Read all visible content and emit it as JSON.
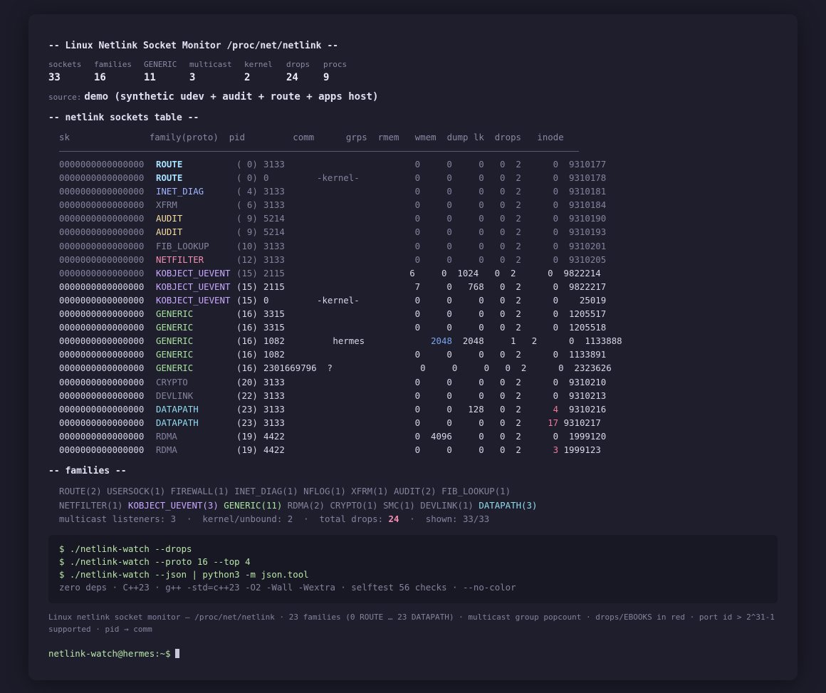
{
  "title": "-- Linux Netlink Socket Monitor /proc/net/netlink --",
  "stats": [
    {
      "label": "sockets",
      "value": "33"
    },
    {
      "label": "families",
      "value": "16"
    },
    {
      "label": "GENERIC",
      "value": "11"
    },
    {
      "label": "multicast",
      "value": "3"
    },
    {
      "label": "kernel",
      "value": "2"
    },
    {
      "label": "drops",
      "value": "24"
    },
    {
      "label": "procs",
      "value": "9"
    }
  ],
  "source": {
    "label": "source:",
    "value": "demo (synthetic udev + audit + route + apps host)"
  },
  "table_section": "-- netlink sockets table --",
  "table_header": "sk               family(proto)  pid         comm      grps  rmem   wmem  dump lk  drops   inode",
  "rows": [
    {
      "sk": "0000000000000000",
      "family": "ROUTE",
      "cls": "f-route",
      "proto": "( 0)",
      "pid": "3133",
      "comm": "",
      "rest": "        0     0     0   0  2      0  9310177",
      "dim": true
    },
    {
      "sk": "0000000000000000",
      "family": "ROUTE",
      "cls": "f-route",
      "proto": "( 0)",
      "pid": "0",
      "comm": "-kernel-",
      "rest": "        0     0     0   0  2      0  9310178",
      "dim": true
    },
    {
      "sk": "0000000000000000",
      "family": "INET_DIAG",
      "cls": "f-inet",
      "proto": "( 4)",
      "pid": "3133",
      "comm": "",
      "rest": "        0     0     0   0  2      0  9310181",
      "dim": true
    },
    {
      "sk": "0000000000000000",
      "family": "XFRM",
      "cls": "f-xfrm",
      "proto": "( 6)",
      "pid": "3133",
      "comm": "",
      "rest": "        0     0     0   0  2      0  9310184",
      "dim": true
    },
    {
      "sk": "0000000000000000",
      "family": "AUDIT",
      "cls": "f-audit",
      "proto": "( 9)",
      "pid": "5214",
      "comm": "",
      "rest": "        0     0     0   0  2      0  9310190",
      "dim": true
    },
    {
      "sk": "0000000000000000",
      "family": "AUDIT",
      "cls": "f-audit",
      "proto": "( 9)",
      "pid": "5214",
      "comm": "",
      "rest": "        0     0     0   0  2      0  9310193",
      "dim": true
    },
    {
      "sk": "0000000000000000",
      "family": "FIB_LOOKUP",
      "cls": "f-fib",
      "proto": "(10)",
      "pid": "3133",
      "comm": "",
      "rest": "        0     0     0   0  2      0  9310201",
      "dim": true
    },
    {
      "sk": "0000000000000000",
      "family": "NETFILTER",
      "cls": "f-nf",
      "proto": "(12)",
      "pid": "3133",
      "comm": "",
      "rest": "        0     0     0   0  2      0  9310205",
      "dim": true
    },
    {
      "sk": "0000000000000000",
      "family": "KOBJECT_UEVENT",
      "cls": "f-kob",
      "proto": "(15)",
      "pid": "2115",
      "comm": "",
      "rest": "       6     0  1024   0  2      0  9822214",
      "dim": true,
      "brightrest": true
    },
    {
      "sk": "0000000000000000",
      "family": "KOBJECT_UEVENT",
      "cls": "f-kob",
      "proto": "(15)",
      "pid": "2115",
      "comm": "",
      "rest": "        7     0   768   0  2      0  9822217",
      "dim": false
    },
    {
      "sk": "0000000000000000",
      "family": "KOBJECT_UEVENT",
      "cls": "f-kob",
      "proto": "(15)",
      "pid": "0",
      "comm": "-kernel-",
      "rest": "        0     0     0   0  2      0    25019",
      "dim": false
    },
    {
      "sk": "0000000000000000",
      "family": "GENERIC",
      "cls": "f-gen",
      "proto": "(16)",
      "pid": "3315",
      "comm": "",
      "rest": "        0     0     0   0  2      0  1205517",
      "dim": false
    },
    {
      "sk": "0000000000000000",
      "family": "GENERIC",
      "cls": "f-gen",
      "proto": "(16)",
      "pid": "3315",
      "comm": "",
      "rest": "        0     0     0   0  2      0  1205518",
      "dim": false
    },
    {
      "sk": "0000000000000000",
      "family": "GENERIC",
      "cls": "f-gen",
      "proto": "(16)",
      "pid": "1082",
      "comm": "   hermes",
      "rest": "           2048  2048     1   2      0  1133888",
      "dim": false,
      "hermes": true
    },
    {
      "sk": "0000000000000000",
      "family": "GENERIC",
      "cls": "f-gen",
      "proto": "(16)",
      "pid": "1082",
      "comm": "",
      "rest": "        0     0     0   0  2      0  1133891",
      "dim": false
    },
    {
      "sk": "0000000000000000",
      "family": "GENERIC",
      "cls": "f-gen",
      "proto": "(16)",
      "pid": "2301669796  ?",
      "comm": "",
      "rest": "         0     0     0   0  2      0  2323626",
      "dim": false
    },
    {
      "sk": "0000000000000000",
      "family": "CRYPTO",
      "cls": "f-crypto",
      "proto": "(20)",
      "pid": "3133",
      "comm": "",
      "rest": "        0     0     0   0  2      0  9310210",
      "dim": false
    },
    {
      "sk": "0000000000000000",
      "family": "DEVLINK",
      "cls": "f-devlink",
      "proto": "(22)",
      "pid": "3133",
      "comm": "",
      "rest": "        0     0     0   0  2      0  9310213",
      "dim": false
    },
    {
      "sk": "0000000000000000",
      "family": "DATAPATH",
      "cls": "f-dp",
      "proto": "(23)",
      "pid": "3133",
      "comm": "",
      "rest": "        0     0   128   0  2      ",
      "drops": "4",
      "inode": "  9310216",
      "dim": false
    },
    {
      "sk": "0000000000000000",
      "family": "DATAPATH",
      "cls": "f-dp",
      "proto": "(23)",
      "pid": "3133",
      "comm": "",
      "rest": "        0     0     0   0  2     ",
      "drops": "17",
      "inode": " 9310217",
      "dim": false
    },
    {
      "sk": "0000000000000000",
      "family": "RDMA",
      "cls": "f-rdma",
      "proto": "(19)",
      "pid": "4422",
      "comm": "",
      "rest": "        0  4096     0   0  2      0  1999120",
      "dim": false
    },
    {
      "sk": "0000000000000000",
      "family": "RDMA",
      "cls": "f-rdma",
      "proto": "(19)",
      "pid": "4422",
      "comm": "",
      "rest": "        0     0     0   0  2      ",
      "drops": "3",
      "inode": " 1999123",
      "dim": false
    }
  ],
  "families_section": "-- families --",
  "families_line1": "ROUTE(2) USERSOCK(1) FIREWALL(1) INET_DIAG(1) NFLOG(1) XFRM(1) AUDIT(2) FIB_LOOKUP(1)",
  "families_line2": [
    {
      "t": "NETFILTER(1) ",
      "c": "mc"
    },
    {
      "t": "KOBJECT_UEVENT(3) ",
      "c": "f-kob"
    },
    {
      "t": "GENERIC(11) ",
      "c": "f-gen"
    },
    {
      "t": "RDMA(2) CRYPTO(1) SMC(1) DEVLINK(1) ",
      "c": "mc"
    },
    {
      "t": "DATAPATH(3)",
      "c": "f-dp"
    }
  ],
  "summary": {
    "a": "multicast listeners: 3  ·  kernel/unbound: 2  ·  total drops: ",
    "b": "24",
    "c": "  ·  shown: 33/33"
  },
  "commands": [
    "$ ./netlink-watch --drops",
    "$ ./netlink-watch --proto 16 --top 4",
    "$ ./netlink-watch --json | python3 -m json.tool"
  ],
  "cmd_note": "zero deps · C++23 · g++ -std=c++23 -O2 -Wall -Wextra · selftest 56 checks · --no-color",
  "footer": "Linux netlink socket monitor — /proc/net/netlink · 23 families (0 ROUTE … 23 DATAPATH) · multicast group popcount · drops/EBOOKS in red · port id > 2^31-1 supported · pid → comm",
  "prompt": "netlink-watch@hermes:~$"
}
